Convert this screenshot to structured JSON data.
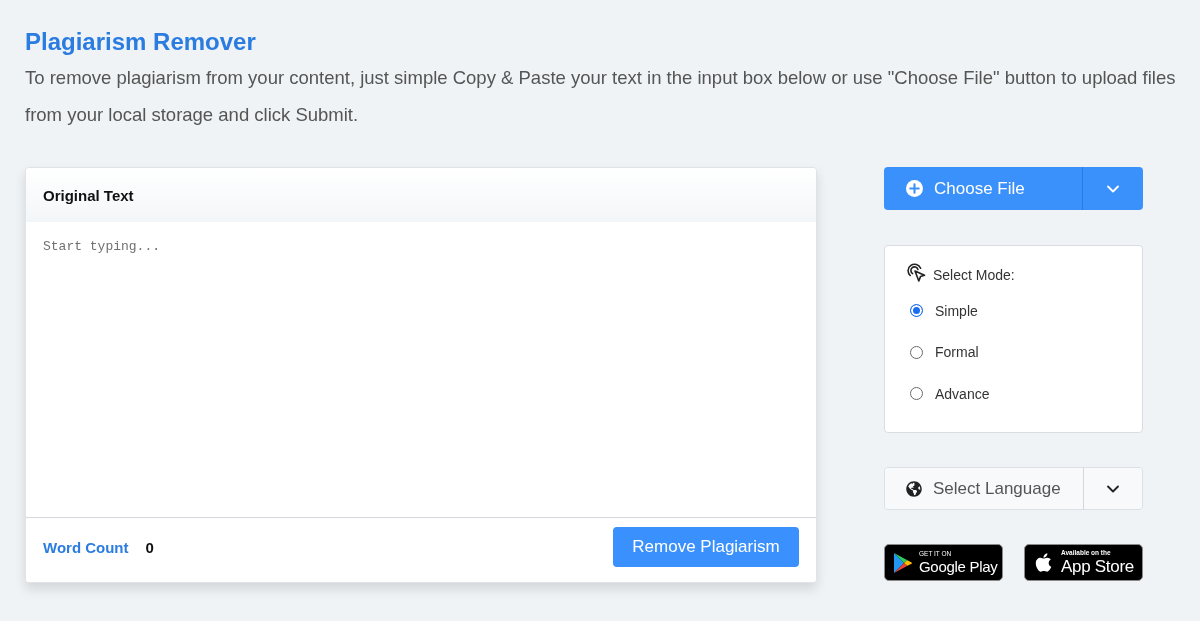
{
  "title": "Plagiarism Remover",
  "intro": "To remove plagiarism from your content, just simple Copy & Paste your text in the input box below or use \"Choose File\" button to upload files from your local storage and click Submit.",
  "editor": {
    "heading": "Original Text",
    "placeholder": "Start typing...",
    "word_count_label": "Word Count",
    "word_count": "0",
    "submit_button": "Remove Plagiarism"
  },
  "choose_file": {
    "label": "Choose File"
  },
  "mode": {
    "label": "Select Mode:",
    "options": [
      {
        "label": "Simple",
        "selected": true
      },
      {
        "label": "Formal",
        "selected": false
      },
      {
        "label": "Advance",
        "selected": false
      }
    ]
  },
  "language": {
    "label": "Select Language"
  },
  "store_badges": [
    {
      "kind": "google-play",
      "small": "GET IT ON",
      "large": "Google Play"
    },
    {
      "kind": "app-store",
      "small": "Available on the",
      "large": "App Store"
    }
  ]
}
